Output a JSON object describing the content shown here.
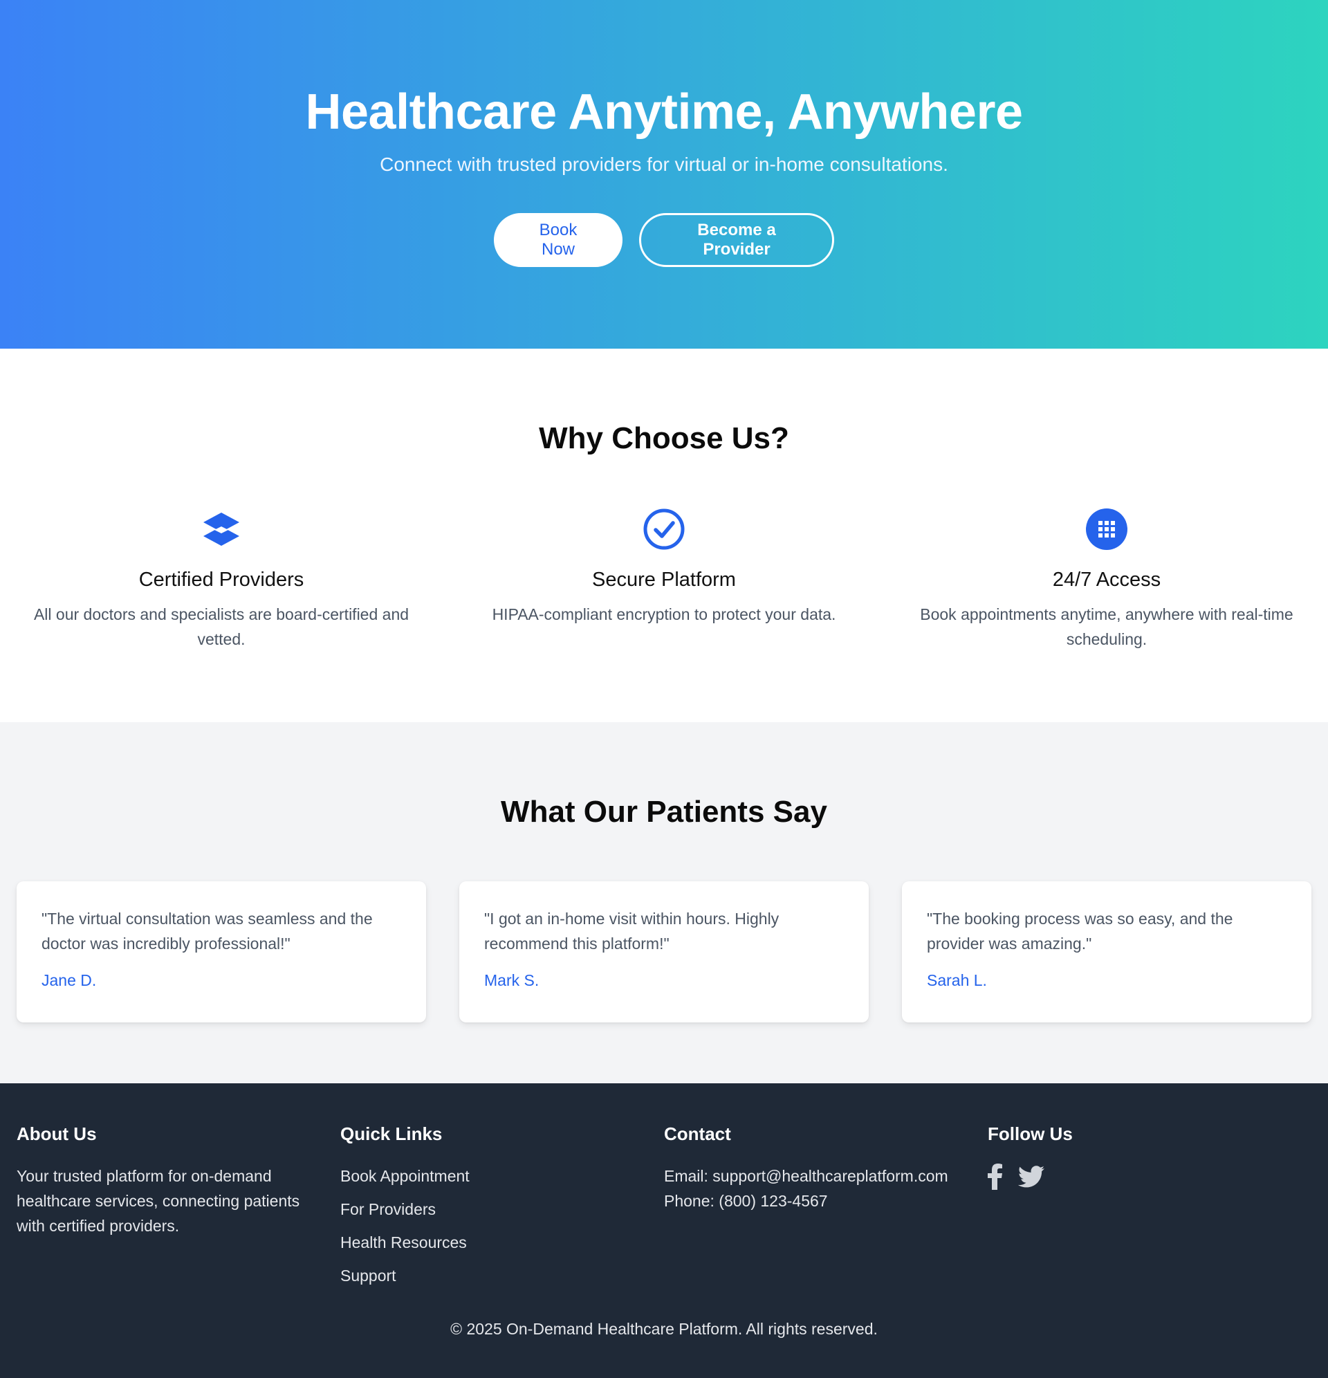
{
  "hero": {
    "title": "Healthcare Anytime, Anywhere",
    "subtitle": "Connect with trusted providers for virtual or in-home consultations.",
    "book_label": "Book Now",
    "provider_label": "Become a Provider",
    "gradient_start": "#3b82f6",
    "gradient_end": "#2dd4bf"
  },
  "why": {
    "title": "Why Choose Us?",
    "features": [
      {
        "icon": "layers-icon",
        "title": "Certified Providers",
        "text": "All our doctors and specialists are board-certified and vetted."
      },
      {
        "icon": "check-circle-icon",
        "title": "Secure Platform",
        "text": "HIPAA-compliant encryption to protect your data."
      },
      {
        "icon": "apps-grid-icon",
        "title": "24/7 Access",
        "text": "Book appointments anytime, anywhere with real-time scheduling."
      }
    ]
  },
  "testimonials": {
    "title": "What Our Patients Say",
    "items": [
      {
        "quote": "\"The virtual consultation was seamless and the doctor was incredibly professional!\"",
        "author": "Jane D."
      },
      {
        "quote": "\"I got an in-home visit within hours. Highly recommend this platform!\"",
        "author": "Mark S."
      },
      {
        "quote": "\"The booking process was so easy, and the provider was amazing.\"",
        "author": "Sarah L."
      }
    ]
  },
  "footer": {
    "about": {
      "title": "About Us",
      "text": "Your trusted platform for on-demand healthcare services, connecting patients with certified providers."
    },
    "links": {
      "title": "Quick Links",
      "items": [
        "Book Appointment",
        "For Providers",
        "Health Resources",
        "Support"
      ]
    },
    "contact": {
      "title": "Contact",
      "email": "Email: support@healthcareplatform.com",
      "phone": "Phone: (800) 123-4567"
    },
    "follow": {
      "title": "Follow Us",
      "icons": [
        "facebook-icon",
        "twitter-icon"
      ]
    },
    "copyright": "© 2025 On-Demand Healthcare Platform. All rights reserved."
  },
  "colors": {
    "accent": "#2563eb",
    "footer_bg": "#1f2937",
    "section_bg": "#f3f4f6"
  }
}
